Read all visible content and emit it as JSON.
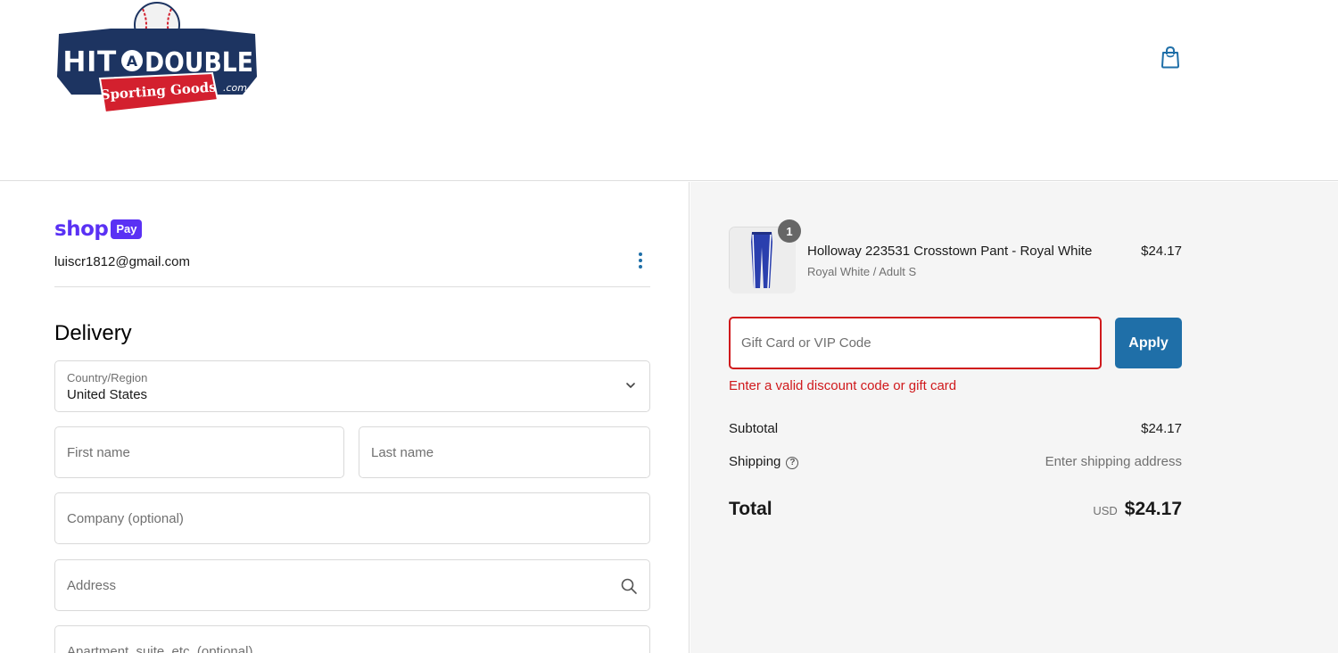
{
  "header": {
    "logo": {
      "line1_left": "HIT",
      "line1_mid": "A",
      "line1_right": "DOUBLE",
      "ribbon": "Sporting Goods",
      "suffix": ".com"
    },
    "cart_icon": "shopping-bag-icon"
  },
  "account": {
    "shop_word": "shop",
    "pay_badge": "Pay",
    "email": "luiscr1812@gmail.com",
    "menu_icon": "kebab-menu-icon"
  },
  "delivery": {
    "title": "Delivery",
    "country_label": "Country/Region",
    "country_value": "United States",
    "first_name_placeholder": "First name",
    "last_name_placeholder": "Last name",
    "company_placeholder": "Company (optional)",
    "address_placeholder": "Address",
    "apartment_placeholder": "Apartment, suite, etc. (optional)"
  },
  "cart": {
    "quantity": "1",
    "product_name": "Holloway 223531 Crosstown Pant - Royal White",
    "product_variant": "Royal White / Adult S",
    "product_price": "$24.17"
  },
  "discount": {
    "placeholder": "Gift Card or VIP Code",
    "apply_label": "Apply",
    "error": "Enter a valid discount code or gift card"
  },
  "summary": {
    "subtotal_label": "Subtotal",
    "subtotal_value": "$24.17",
    "shipping_label": "Shipping",
    "shipping_value": "Enter shipping address",
    "total_label": "Total",
    "currency": "USD",
    "total_value": "$24.17"
  },
  "colors": {
    "accent": "#1f6fa8",
    "shop_purple": "#5a31f4",
    "error": "#d0191c",
    "logo_navy": "#1d3461",
    "logo_red": "#d3202e"
  }
}
